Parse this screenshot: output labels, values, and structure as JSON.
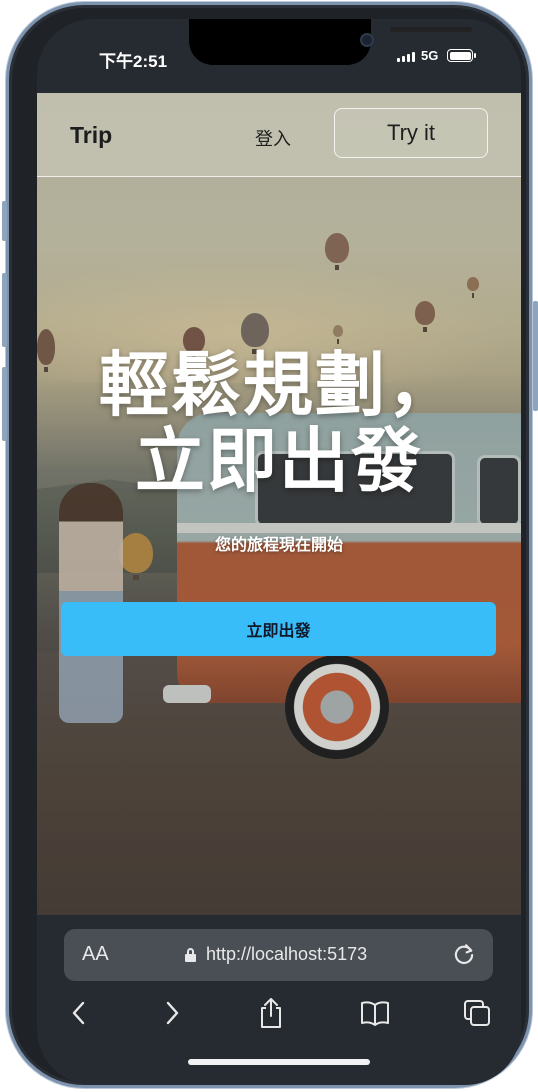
{
  "status_bar": {
    "time": "下午2:51",
    "network": "5G",
    "signal_icon": "signal-bars-icon",
    "battery_icon": "battery-icon"
  },
  "navbar": {
    "brand": "Trip",
    "login_label": "登入",
    "try_label": "Try it"
  },
  "hero": {
    "headline_line1": "輕鬆規劃，",
    "headline_line2": "立即出發",
    "subtitle": "您的旅程現在開始",
    "cta_label": "立即出發",
    "cta_color": "#38bdf8"
  },
  "browser": {
    "text_size_label": "AA",
    "url": "http://localhost:5173",
    "toolbar": [
      "back-icon",
      "forward-icon",
      "share-icon",
      "bookmarks-icon",
      "tabs-icon"
    ]
  }
}
